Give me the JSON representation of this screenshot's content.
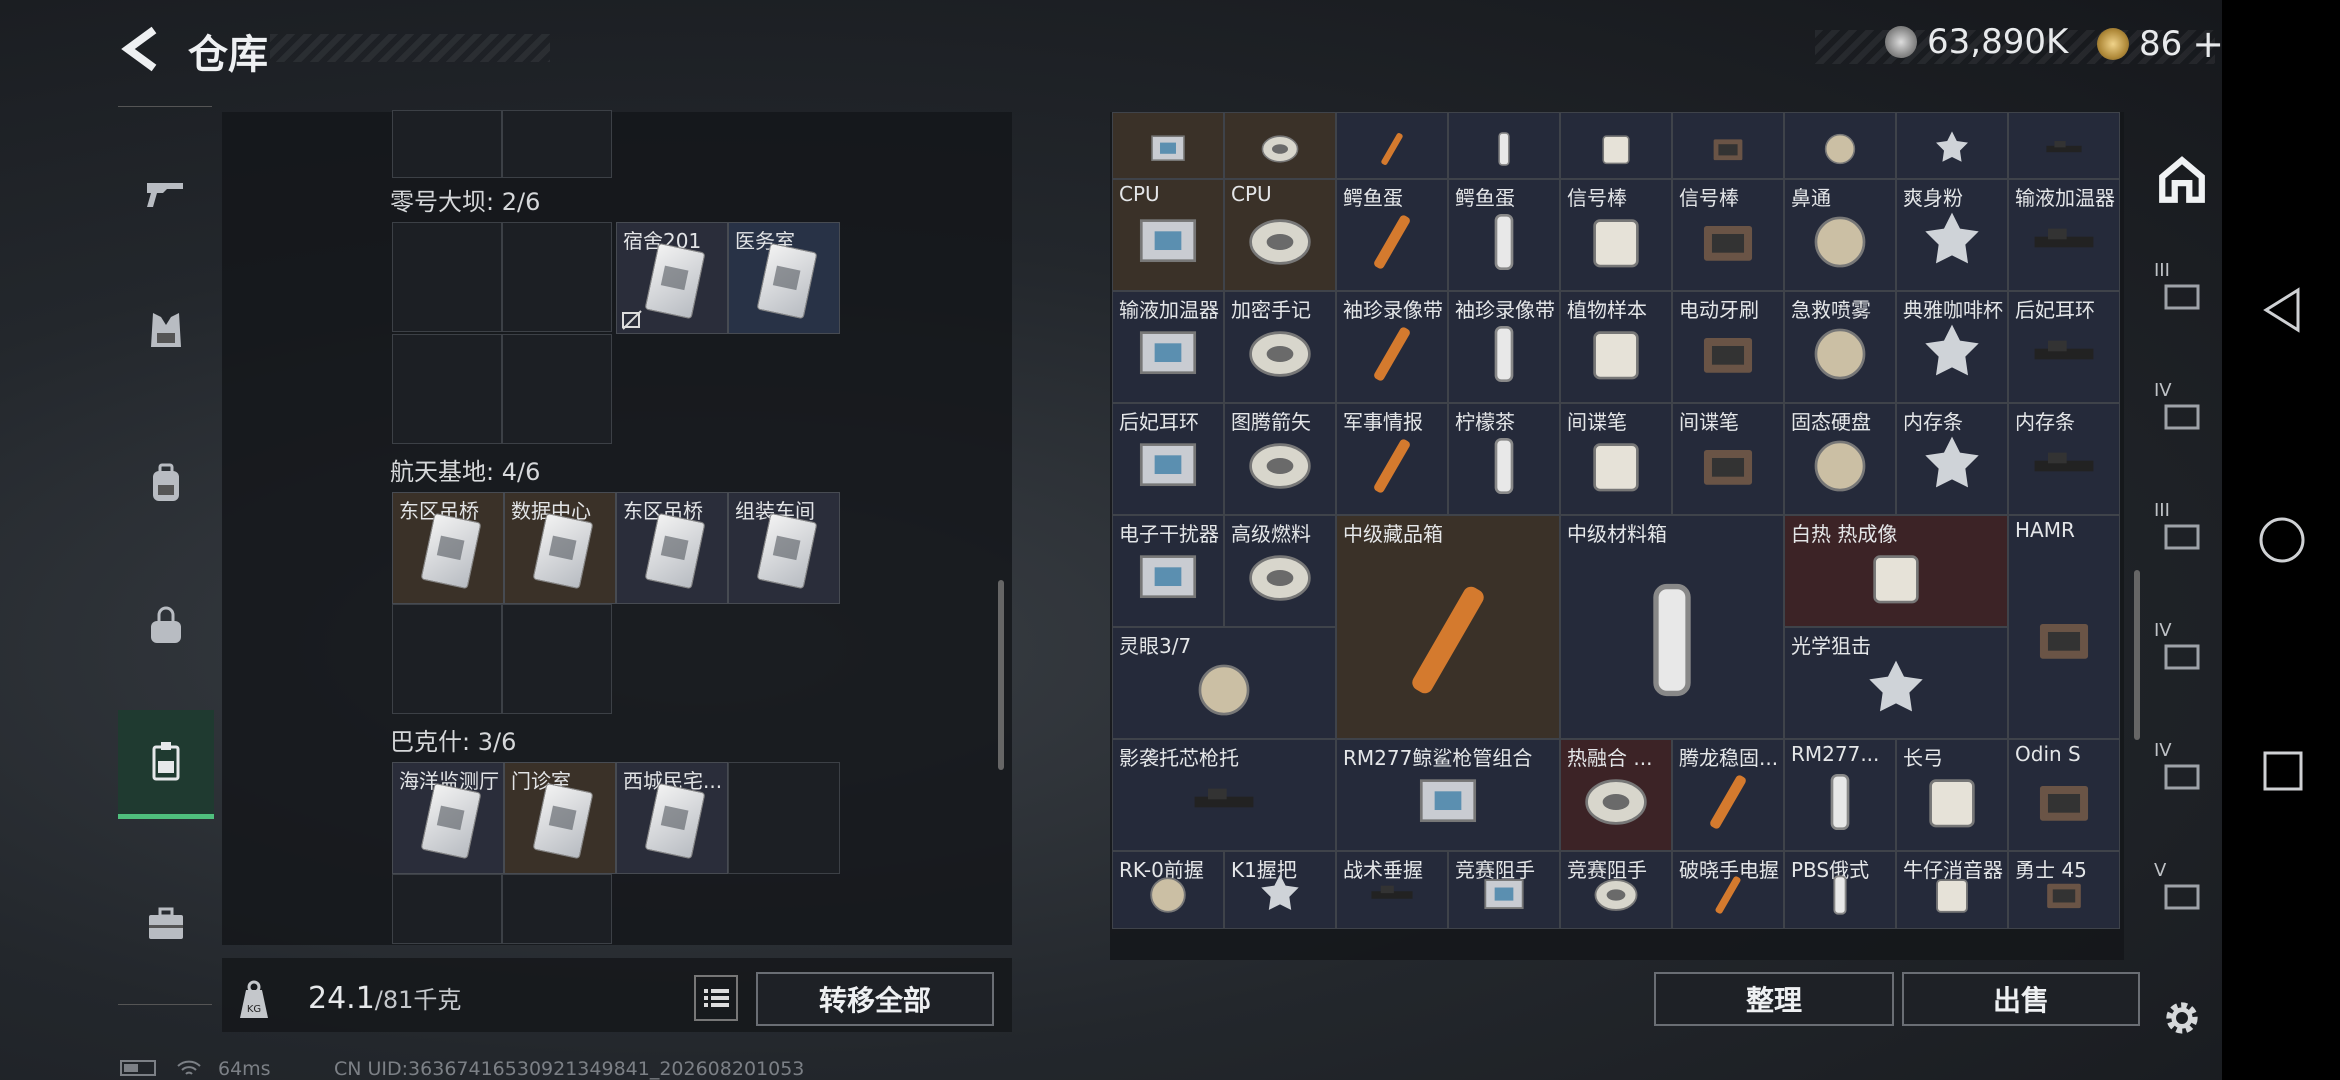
{
  "header": {
    "title": "仓库",
    "currency1": "63,890K",
    "currency2": "86",
    "currency2_plus": "+"
  },
  "colors": {
    "accent_green": "#4fbf7d",
    "gold_cell": "#3a3128",
    "red_cell": "#3c2326",
    "blue_cell": "#252a3a"
  },
  "left_nav": {
    "icons": [
      "gun-icon",
      "vest-icon",
      "backpack-icon",
      "bag-icon",
      "keycard-icon",
      "briefcase-icon"
    ],
    "active_index": 4
  },
  "sections": [
    {
      "title": "零号大坝: 2/6",
      "cards": [
        "宿舍201",
        "医务室"
      ]
    },
    {
      "title": "航天基地: 4/6",
      "cards": [
        "东区吊桥",
        "数据中心",
        "东区吊桥",
        "组装车间"
      ]
    },
    {
      "title": "巴克什: 3/6",
      "cards": [
        "海洋监测厅",
        "门诊室",
        "西城民宅..."
      ]
    }
  ],
  "footer_left": {
    "weight_value": "24.1",
    "weight_max": "/81千克",
    "weight_icon": "KG",
    "transfer_all": "转移全部"
  },
  "footer_right": {
    "organize": "整理",
    "sell": "出售"
  },
  "items": [
    "CPU",
    "CPU",
    "鳄鱼蛋",
    "鳄鱼蛋",
    "信号棒",
    "信号棒",
    "鼻通",
    "爽身粉",
    "输液加温器",
    "输液加温器",
    "加密手记",
    "袖珍录像带",
    "袖珍录像带",
    "植物样本",
    "电动牙刷",
    "急救喷雾",
    "典雅咖啡杯",
    "后妃耳环",
    "后妃耳环",
    "图腾箭矢",
    "军事情报",
    "柠檬茶",
    "间谍笔",
    "间谍笔",
    "固态硬盘",
    "内存条",
    "内存条",
    "电子干扰器",
    "高级燃料",
    "中级藏品箱",
    "中级材料箱",
    "白热 热成像",
    "HAMR",
    "灵眼3/7",
    "光学狙击",
    "影袭托芯枪托",
    "RM277鲸鲨枪管组合",
    "热融合 ...",
    "腾龙稳固...",
    "RM277...",
    "长弓",
    "Odin S",
    "RK-0前握",
    "K1握把",
    "战术垂握",
    "竞赛阻手",
    "竞赛阻手",
    "破晓手电握",
    "PBS俄式",
    "牛仔消音器",
    "勇士 45"
  ],
  "right_sidebar": [
    "home-icon",
    "III",
    "IV",
    "III",
    "IV",
    "IV",
    "V",
    "gear-icon"
  ],
  "status_bar": {
    "ping": "64ms",
    "uid": "CN UID:36367416530921349841_202608201053"
  }
}
